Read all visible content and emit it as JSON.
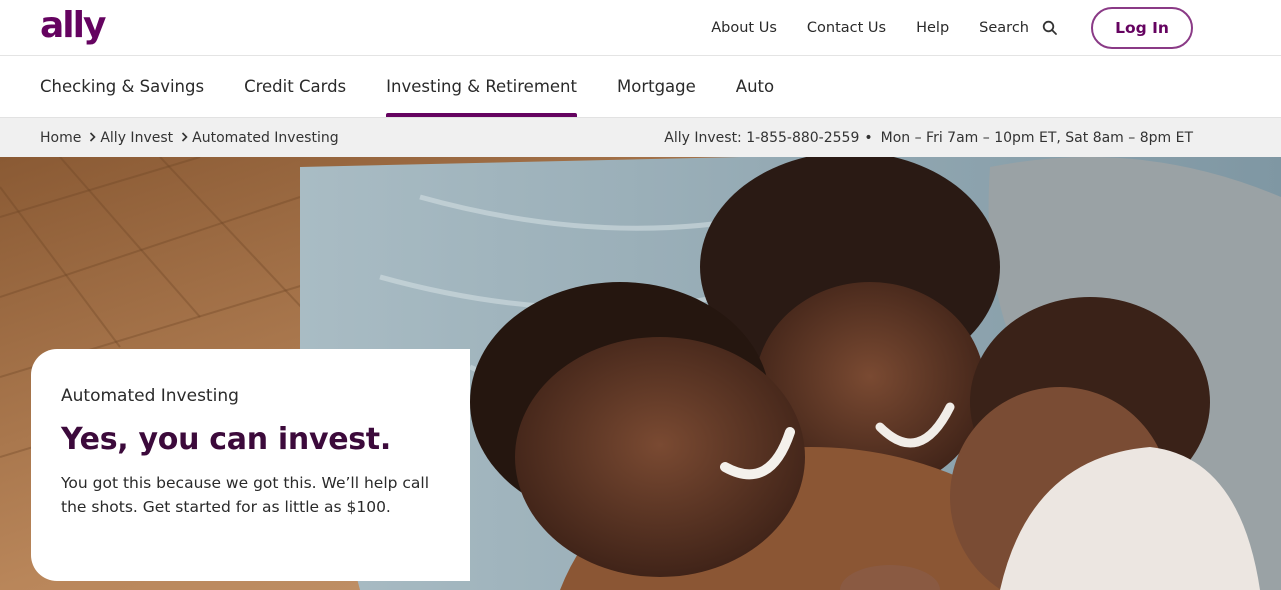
{
  "brand": {
    "logo_text": "ally",
    "color": "#650360"
  },
  "utility_nav": {
    "links": [
      "About Us",
      "Contact Us",
      "Help",
      "Search"
    ],
    "search_icon": "search-icon",
    "login_label": "Log In"
  },
  "main_nav": {
    "items": [
      "Checking & Savings",
      "Credit Cards",
      "Investing & Retirement",
      "Mortgage",
      "Auto"
    ],
    "active": "Investing & Retirement"
  },
  "breadcrumb": {
    "items": [
      "Home",
      "Ally Invest",
      "Automated Investing"
    ],
    "separator": "chevron-right-icon"
  },
  "contact": {
    "phone": "Ally Invest: 1-855-880-2559",
    "hours": "Mon – Fri 7am – 10pm ET, Sat 8am – 8pm ET"
  },
  "hero": {
    "image": "family-lying-on-bed-photo",
    "eyebrow": "Automated Investing",
    "headline": "Yes, you can invest.",
    "body": "You got this because we got this. We’ll help call the shots. Get started for as little as $100."
  }
}
